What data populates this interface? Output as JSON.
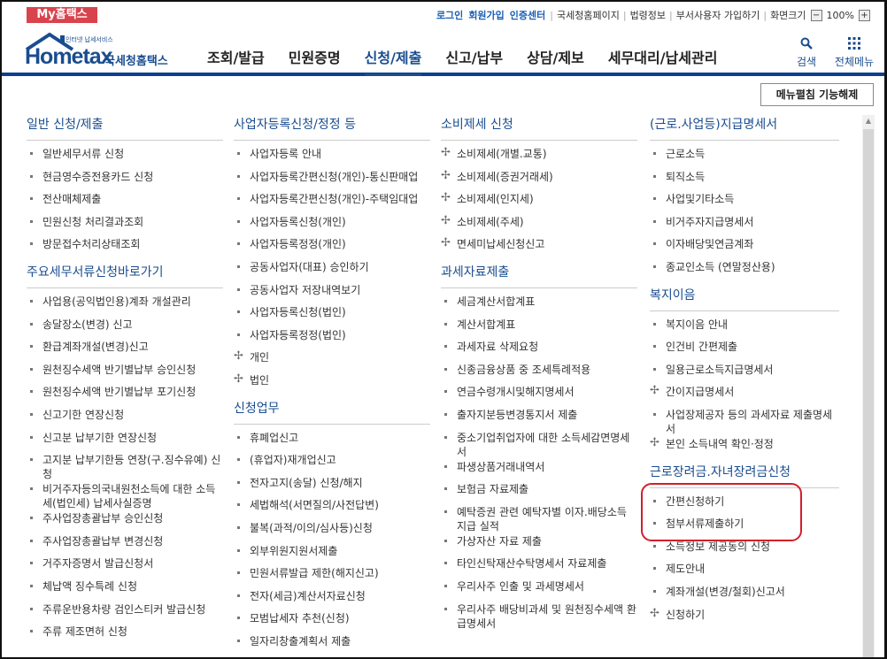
{
  "topbar": {
    "badge": "My홈택스",
    "links": [
      "로그인",
      "회원가입",
      "인증센터",
      "국세청홈페이지",
      "법령정보",
      "부서사용자 가입하기",
      "화면크기"
    ],
    "zoom_out": "−",
    "zoom": "100%",
    "zoom_in": "+"
  },
  "header": {
    "logo_small": "인터넷 납세서비스",
    "logo_home": "Hometax",
    "logo_kr": "국세청홈택스",
    "nav": [
      "조회/발급",
      "민원증명",
      "신청/제출",
      "신고/납부",
      "상담/제보",
      "세무대리/납세관리"
    ],
    "search": "검색",
    "allmenu": "전체메뉴"
  },
  "toggle": "메뉴펼침 기능해제",
  "columns": [
    {
      "groups": [
        {
          "title": "일반 신청/제출",
          "items": [
            {
              "t": "일반세무서류 신청",
              "p": false
            },
            {
              "t": "현금영수증전용카드 신청",
              "p": false
            },
            {
              "t": "전산매체제출",
              "p": false
            },
            {
              "t": "민원신청 처리결과조회",
              "p": false
            },
            {
              "t": "방문접수처리상태조회",
              "p": false
            }
          ]
        },
        {
          "title": "주요세무서류신청바로가기",
          "items": [
            {
              "t": "사업용(공익법인용)계좌 개설관리",
              "p": false
            },
            {
              "t": "송달장소(변경) 신고",
              "p": false
            },
            {
              "t": "환급계좌개설(변경)신고",
              "p": false
            },
            {
              "t": "원천징수세액 반기별납부 승인신청",
              "p": false
            },
            {
              "t": "원천징수세액 반기별납부 포기신청",
              "p": false
            },
            {
              "t": "신고기한 연장신청",
              "p": false
            },
            {
              "t": "신고분 납부기한 연장신청",
              "p": false
            },
            {
              "t": "고지분 납부기한등 연장(구.징수유예) 신청",
              "p": false
            },
            {
              "t": "비거주자등의국내원천소득에 대한 소득세(법인세) 납세사실증명",
              "p": false
            },
            {
              "t": "주사업장총괄납부 승인신청",
              "p": false
            },
            {
              "t": "주사업장총괄납부 변경신청",
              "p": false
            },
            {
              "t": "거주자증명서 발급신청서",
              "p": false
            },
            {
              "t": "체납액 징수특례 신청",
              "p": false
            },
            {
              "t": "주류운반용차량 검인스티커 발급신청",
              "p": false
            },
            {
              "t": "주류 제조면허 신청",
              "p": false
            }
          ]
        }
      ]
    },
    {
      "groups": [
        {
          "title": "사업자등록신청/정정 등",
          "items": [
            {
              "t": "사업자등록 안내",
              "p": false
            },
            {
              "t": "사업자등록간편신청(개인)-통신판매업",
              "p": false
            },
            {
              "t": "사업자등록간편신청(개인)-주택임대업",
              "p": false
            },
            {
              "t": "사업자등록신청(개인)",
              "p": false
            },
            {
              "t": "사업자등록정정(개인)",
              "p": false
            },
            {
              "t": "공동사업자(대표) 승인하기",
              "p": false
            },
            {
              "t": "공동사업자 저장내역보기",
              "p": false
            },
            {
              "t": "사업자등록신청(법인)",
              "p": false
            },
            {
              "t": "사업자등록정정(법인)",
              "p": false
            },
            {
              "t": "개인",
              "p": true
            },
            {
              "t": "법인",
              "p": true
            }
          ]
        },
        {
          "title": "신청업무",
          "items": [
            {
              "t": "휴폐업신고",
              "p": false
            },
            {
              "t": "(휴업자)재개업신고",
              "p": false
            },
            {
              "t": "전자고지(송달) 신청/해지",
              "p": false
            },
            {
              "t": "세법해석(서면질의/사전답변)",
              "p": false
            },
            {
              "t": "불복(과적/이의/심사등)신청",
              "p": false
            },
            {
              "t": "외부위원지원서제출",
              "p": false
            },
            {
              "t": "민원서류발급 제한(해지신고)",
              "p": false
            },
            {
              "t": "전자(세금)계산서자료신청",
              "p": false
            },
            {
              "t": "모범납세자 추천(신청)",
              "p": false
            },
            {
              "t": "일자리창출계획서 제출",
              "p": false
            }
          ]
        }
      ]
    },
    {
      "groups": [
        {
          "title": "소비제세 신청",
          "items": [
            {
              "t": "소비제세(개별.교통)",
              "p": true
            },
            {
              "t": "소비제세(증권거래세)",
              "p": true
            },
            {
              "t": "소비제세(인지세)",
              "p": true
            },
            {
              "t": "소비제세(주세)",
              "p": true
            },
            {
              "t": "면세미납세신청신고",
              "p": true
            }
          ]
        },
        {
          "title": "과세자료제출",
          "items": [
            {
              "t": "세금계산서합계표",
              "p": false
            },
            {
              "t": "계산서합계표",
              "p": false
            },
            {
              "t": "과세자료 삭제요청",
              "p": false
            },
            {
              "t": "신종금융상품 중 조세특례적용",
              "p": false
            },
            {
              "t": "연금수령개시및해지명세서",
              "p": false
            },
            {
              "t": "출자지분등변경통지서 제출",
              "p": false
            },
            {
              "t": "중소기업취업자에 대한 소득세감면명세서",
              "p": false
            },
            {
              "t": "파생상품거래내역서",
              "p": false
            },
            {
              "t": "보험금 자료제출",
              "p": false
            },
            {
              "t": "예탁증권 관련 예탁자별 이자.배당소득 지급 실적",
              "p": false
            },
            {
              "t": "가상자산 자료 제출",
              "p": false
            },
            {
              "t": "타인신탁재산수탁명세서 자료제출",
              "p": false
            },
            {
              "t": "우리사주 인출 및 과세명세서",
              "p": false
            },
            {
              "t": "우리사주 배당비과세 및 원천징수세액 환급명세서",
              "p": false
            }
          ]
        }
      ]
    },
    {
      "groups": [
        {
          "title": "(근로.사업등)지급명세서",
          "items": [
            {
              "t": "근로소득",
              "p": false
            },
            {
              "t": "퇴직소득",
              "p": false
            },
            {
              "t": "사업및기타소득",
              "p": false
            },
            {
              "t": "비거주자지급명세서",
              "p": false
            },
            {
              "t": "이자배당및연금계좌",
              "p": false
            },
            {
              "t": "종교인소득 (연말정산용)",
              "p": false
            }
          ]
        },
        {
          "title": "복지이음",
          "items": [
            {
              "t": "복지이음 안내",
              "p": false
            },
            {
              "t": "인건비 간편제출",
              "p": false
            },
            {
              "t": "일용근로소득지급명세서",
              "p": false
            },
            {
              "t": "간이지급명세서",
              "p": true
            },
            {
              "t": "사업장제공자 등의 과세자료 제출명세서",
              "p": false
            },
            {
              "t": "본인 소득내역 확인·정정",
              "p": true
            }
          ]
        },
        {
          "title": "근로장려금.자녀장려금신청",
          "items": [
            {
              "t": "간편신청하기",
              "p": false
            },
            {
              "t": "첨부서류제출하기",
              "p": false
            },
            {
              "t": "소득정보 제공동의 신청",
              "p": false
            },
            {
              "t": "제도안내",
              "p": false
            },
            {
              "t": "계좌개설(변경/철회)신고서",
              "p": false
            },
            {
              "t": "신청하기",
              "p": true
            }
          ]
        }
      ]
    }
  ]
}
